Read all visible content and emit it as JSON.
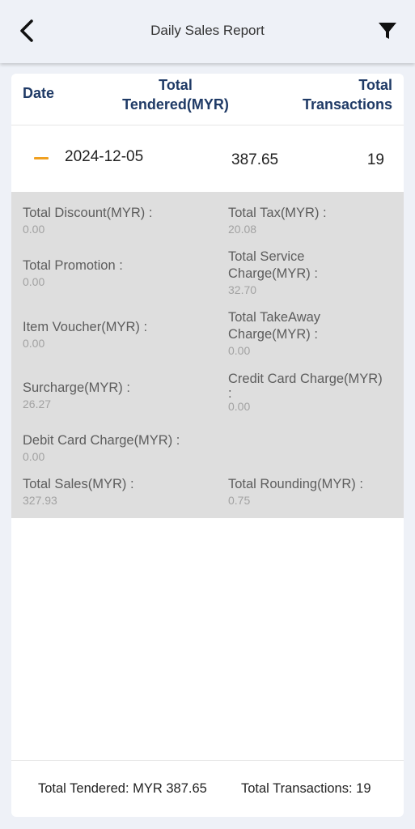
{
  "header": {
    "title": "Daily Sales Report",
    "back_icon": "chevron-left-icon",
    "filter_icon": "filter-funnel-icon"
  },
  "table": {
    "columns": {
      "date": "Date",
      "tendered_line1": "Total",
      "tendered_line2": "Tendered(MYR)",
      "transactions_line1": "Total",
      "transactions_line2": "Transactions"
    },
    "row": {
      "date": "2024-12-05",
      "tendered": "387.65",
      "transactions": "19",
      "expanded": true
    }
  },
  "details": {
    "total_discount": {
      "label": "Total Discount(MYR) :",
      "value": "0.00"
    },
    "total_tax": {
      "label": "Total Tax(MYR) :",
      "value": "20.08"
    },
    "total_promotion": {
      "label": "Total Promotion :",
      "value": "0.00"
    },
    "total_service_charge": {
      "label_line1": "Total Service",
      "label_line2": "Charge(MYR) :",
      "value": "32.70"
    },
    "item_voucher": {
      "label": "Item Voucher(MYR) :",
      "value": "0.00"
    },
    "total_takeaway_charge": {
      "label_line1": "Total TakeAway",
      "label_line2": "Charge(MYR) :",
      "value": "0.00"
    },
    "surcharge": {
      "label": "Surcharge(MYR) :",
      "value": "26.27"
    },
    "credit_card_charge": {
      "label_line1": "Credit Card Charge(MYR)",
      "label_line2": ":",
      "value": "0.00"
    },
    "debit_card_charge": {
      "label": "Debit Card Charge(MYR) :",
      "value": "0.00"
    },
    "total_sales": {
      "label": "Total Sales(MYR) :",
      "value": "327.93"
    },
    "total_rounding": {
      "label": "Total Rounding(MYR) :",
      "value": "0.75"
    }
  },
  "footer": {
    "total_tendered": "Total Tendered: MYR 387.65",
    "total_transactions": "Total Transactions: 19"
  },
  "colors": {
    "background": "#eef1f7",
    "header_text": "#1f3a66",
    "accent": "#f0a020",
    "details_bg": "#dedede"
  }
}
